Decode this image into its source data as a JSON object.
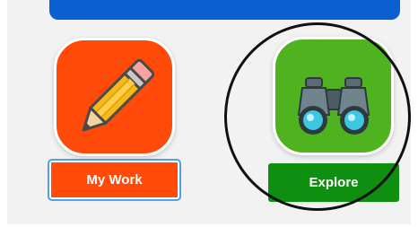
{
  "tiles": [
    {
      "id": "my-work",
      "label": "My Work",
      "icon": "pencil-icon",
      "color": "#ff4a0a",
      "selected": true
    },
    {
      "id": "explore",
      "label": "Explore",
      "icon": "binoculars-icon",
      "color": "#4fb31f",
      "label_color": "#0f8f0f"
    }
  ],
  "top_bar": {
    "color": "#0c5fd1"
  },
  "annotation": {
    "type": "circle",
    "target": "explore",
    "color": "#111111"
  }
}
